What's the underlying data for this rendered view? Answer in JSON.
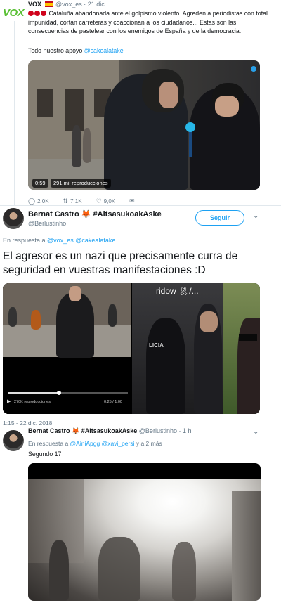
{
  "tweet1": {
    "logo": "VOX",
    "name": "VOX",
    "handle": "@vox_es",
    "date": "· 21 dic.",
    "body": "Cataluña abandonada ante el golpismo violento. Agreden a periodistas con total impunidad, cortan carreteras y coaccionan a los ciudadanos... Estas son las consecuencias de pastelear con los enemigos de España y de la democracia.",
    "support_prefix": "Todo nuestro apoyo ",
    "support_mention": "@cakealatake",
    "video_time": "0:59",
    "video_views": "291 mil reproducciones",
    "replies": "2,0K",
    "retweets": "7,1K",
    "likes": "9,0K"
  },
  "tweet2": {
    "name": "Bernat Castro 🦊 #AltsasukoakAske",
    "handle": "@Berlustinho",
    "follow": "Seguir",
    "reply_prefix": "En respuesta a ",
    "reply_mention1": "@vox_es",
    "reply_mention2": "@cakealatake",
    "text": "El agresor es un nazi que precisamente curra de seguridad en vuestras manifestaciones :D",
    "video_views": "270K reproducciones",
    "video_time": "0:25 / 1:00",
    "overlay_text": "ridow 🎗/...",
    "police_text": "LICIA",
    "date": "1:15 - 22 dic. 2018"
  },
  "tweet3": {
    "name": "Bernat Castro 🦊 #AltsasukoakAske",
    "handle": "@Berlustinho · 1 h",
    "reply_prefix": "En respuesta a ",
    "reply_mention1": "@AiniApgg",
    "reply_mention2": "@xavi_persi",
    "reply_suffix": " y a 2 más",
    "text": "Segundo 17"
  }
}
